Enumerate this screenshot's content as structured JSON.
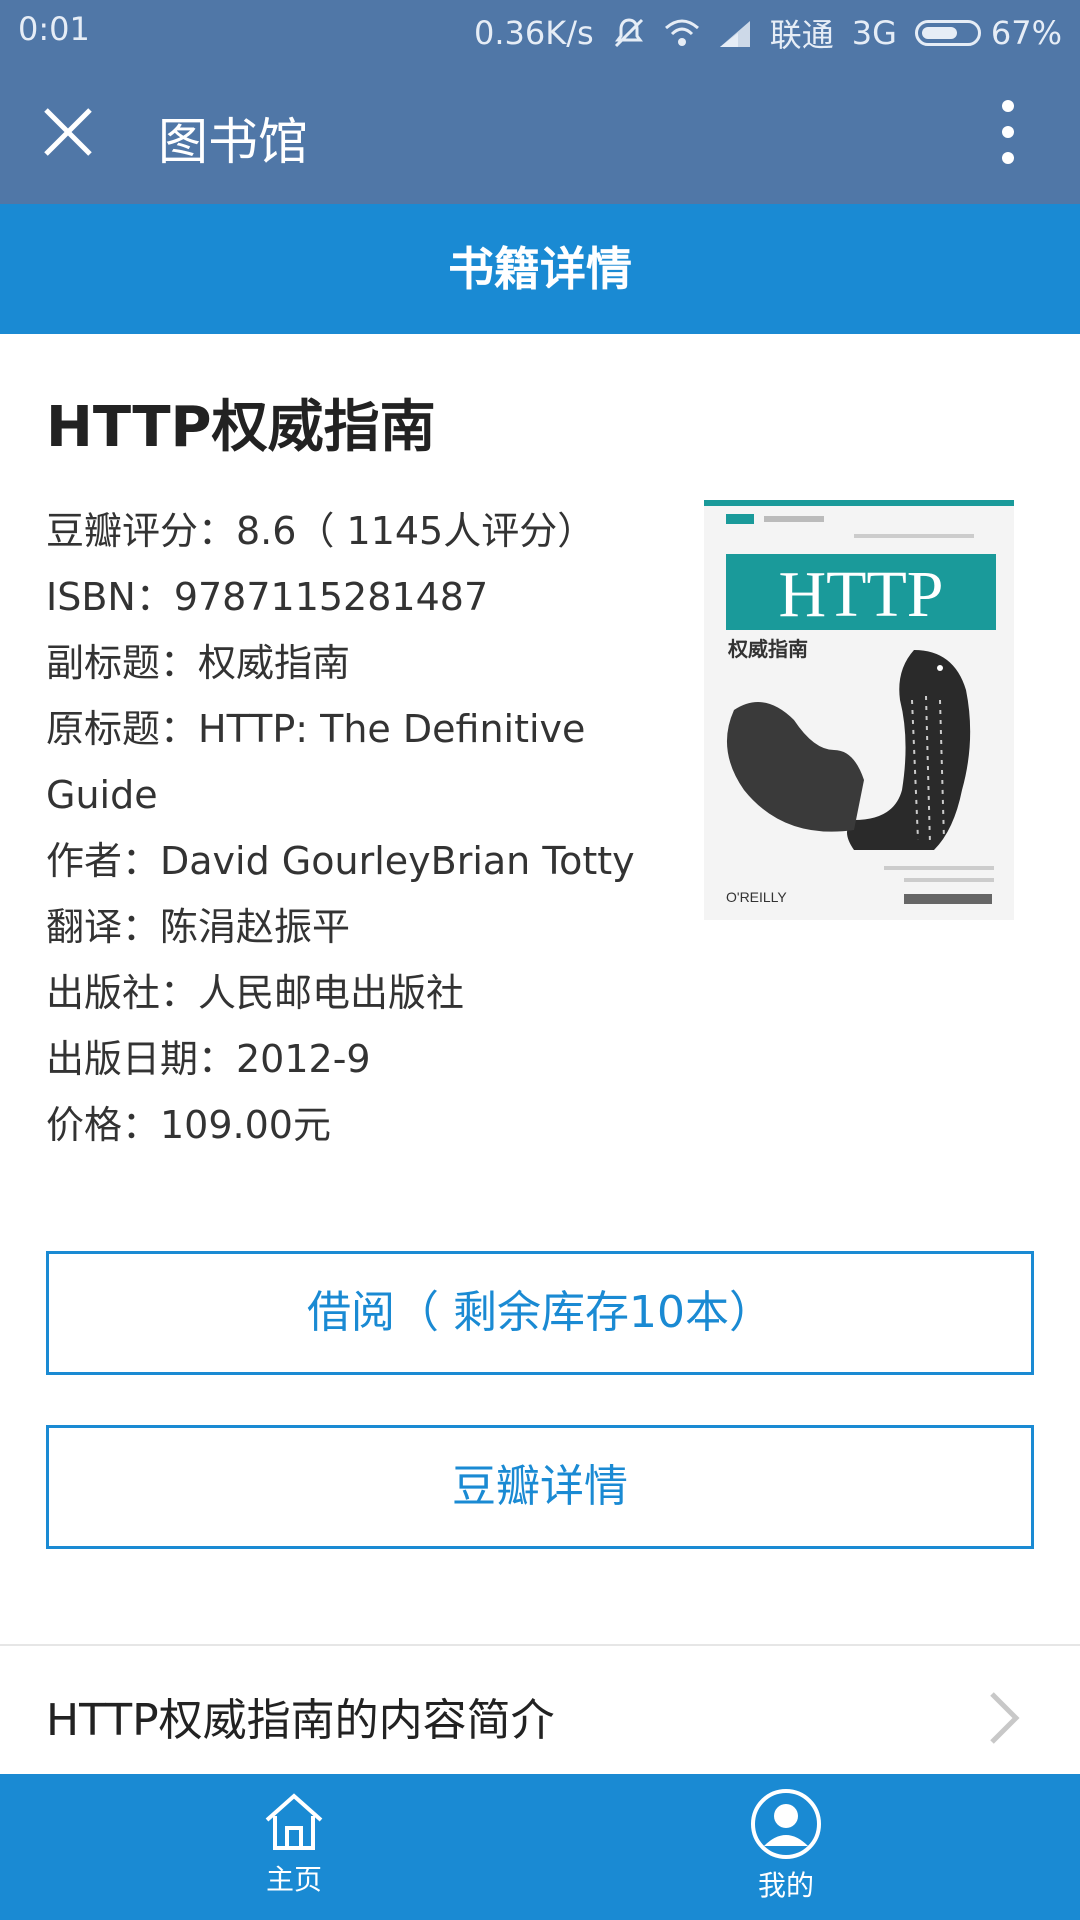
{
  "status_bar": {
    "time": "0:01",
    "network_speed": "0.36K/s",
    "carrier": "联通",
    "network_type": "3G",
    "battery": "67%",
    "battery_level": 0.67,
    "icons": [
      "mute-icon",
      "wifi-icon",
      "signal-icon",
      "battery-icon"
    ]
  },
  "app_bar": {
    "title": "图书馆",
    "icons": [
      "close-icon",
      "more-vertical-icon"
    ]
  },
  "header": {
    "title": "书籍详情"
  },
  "book": {
    "title": "HTTP权威指南",
    "details": [
      "豆瓣评分：8.6（ 1145人评分）",
      "ISBN：9787115281487",
      "副标题：权威指南",
      "原标题：HTTP: The Definitive Guide",
      "作者：David GourleyBrian Totty",
      "翻译：陈涓赵振平",
      "出版社：人民邮电出版社",
      "出版日期：2012-9",
      "价格：109.00元"
    ],
    "cover": {
      "title": "HTTP",
      "subtitle": "权威指南",
      "publisher_mark": "O'REILLY",
      "accent_color": "#1a9a9a"
    }
  },
  "actions": {
    "borrow_label": "借阅（ 剩余库存10本）",
    "douban_label": "豆瓣详情"
  },
  "intro": {
    "label": "HTTP权威指南的内容简介",
    "icon": "chevron-right-icon"
  },
  "tab_bar": {
    "tabs": [
      {
        "label": "主页",
        "icon": "home-icon"
      },
      {
        "label": "我的",
        "icon": "user-icon"
      }
    ]
  },
  "colors": {
    "app_bar": "#5077a7",
    "accent": "#1a8ad3",
    "text": "#222222"
  }
}
